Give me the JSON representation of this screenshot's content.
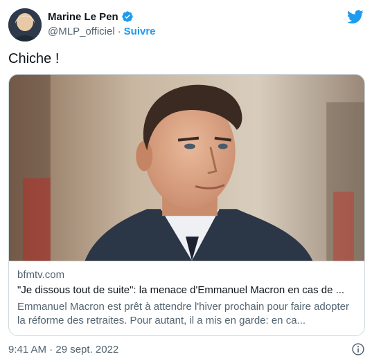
{
  "author": {
    "display_name": "Marine Le Pen",
    "handle": "@MLP_officiel",
    "separator": "·",
    "follow_label": "Suivre",
    "verified_icon": "verified-badge-icon",
    "avatar_icon": "avatar-photo"
  },
  "brand": {
    "logo_icon": "twitter-bird-icon",
    "color": "#1d9bf0"
  },
  "tweet": {
    "text": "Chiche !"
  },
  "card": {
    "image_icon": "news-photo-portrait",
    "domain": "bfmtv.com",
    "title": "\"Je dissous tout de suite\": la menace d'Emmanuel Macron en cas de ...",
    "description": "Emmanuel Macron est prêt à attendre l'hiver prochain pour faire adopter la réforme des retraites. Pour autant, il a mis en garde: en ca..."
  },
  "footer": {
    "timestamp": "9:41 AM · 29 sept. 2022",
    "info_icon": "info-icon"
  },
  "colors": {
    "accent": "#1d9bf0",
    "text": "#0f1419",
    "muted": "#536471",
    "border": "#cfd9de"
  }
}
